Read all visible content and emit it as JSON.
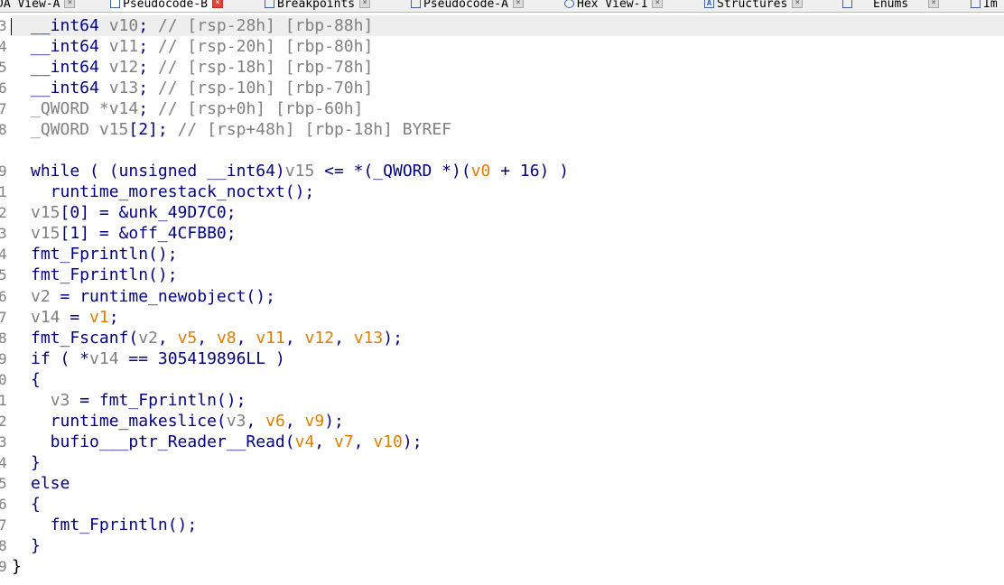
{
  "tabs": [
    {
      "label": "DA View-A",
      "icon": "none",
      "close": "normal",
      "active": false
    },
    {
      "label": "Pseudocode-B",
      "icon": "pseudocode-icon",
      "close": "red",
      "active": true
    },
    {
      "label": "Breakpoints",
      "icon": "breakpoints-icon",
      "close": "normal",
      "active": false
    },
    {
      "label": "Pseudocode-A",
      "icon": "pseudocode-icon",
      "close": "normal",
      "active": false
    },
    {
      "label": "Hex View-1",
      "icon": "hex-icon",
      "close": "normal",
      "active": false
    },
    {
      "label": "Structures",
      "icon": "structures-icon",
      "close": "normal",
      "active": false
    },
    {
      "label": "Enums",
      "icon": "enums-icon",
      "close": "normal",
      "active": false
    },
    {
      "label": "Im",
      "icon": "imports-icon",
      "close": "none",
      "active": false
    }
  ],
  "line_numbers": [
    "3",
    "4",
    "5",
    "6",
    "7",
    "8",
    "",
    "9",
    "1",
    "2",
    "3",
    "4",
    "5",
    "6",
    "7",
    "8",
    "9",
    "0",
    "1",
    "2",
    "3",
    "4",
    "5",
    "6",
    "7",
    "8",
    "9"
  ],
  "code_lines": [
    [
      [
        "__int64 ",
        "t-text"
      ],
      [
        "v10",
        "t-var"
      ],
      [
        "; ",
        "t-text"
      ],
      [
        "// [rsp-28h] [rbp-88h]",
        "t-cmt"
      ]
    ],
    [
      [
        "__int64 ",
        "t-text"
      ],
      [
        "v11",
        "t-var"
      ],
      [
        "; ",
        "t-text"
      ],
      [
        "// [rsp-20h] [rbp-80h]",
        "t-cmt"
      ]
    ],
    [
      [
        "__int64 ",
        "t-text"
      ],
      [
        "v12",
        "t-var"
      ],
      [
        "; ",
        "t-text"
      ],
      [
        "// [rsp-18h] [rbp-78h]",
        "t-cmt"
      ]
    ],
    [
      [
        "__int64 ",
        "t-text"
      ],
      [
        "v13",
        "t-var"
      ],
      [
        "; ",
        "t-text"
      ],
      [
        "// [rsp-10h] [rbp-70h]",
        "t-cmt"
      ]
    ],
    [
      [
        "_QWORD *",
        "t-var"
      ],
      [
        "v14",
        "t-var"
      ],
      [
        "; ",
        "t-text"
      ],
      [
        "// [rsp+0h] [rbp-60h]",
        "t-cmt"
      ]
    ],
    [
      [
        "_QWORD ",
        "t-var"
      ],
      [
        "v15",
        "t-var"
      ],
      [
        "[2]; ",
        "t-text"
      ],
      [
        "// [rsp+48h] [rbp-18h] BYREF",
        "t-cmt"
      ]
    ],
    [],
    [
      [
        "while ( (unsigned __int64)",
        "t-text"
      ],
      [
        "v15",
        "t-var"
      ],
      [
        " <= *(_QWORD *)(",
        "t-text"
      ],
      [
        "v0",
        "t-arg"
      ],
      [
        " + 16) )",
        "t-text"
      ]
    ],
    [
      [
        "  runtime_morestack_noctxt();",
        "t-text"
      ]
    ],
    [
      [
        "v15",
        "t-var"
      ],
      [
        "[0] = &unk_49D7C0;",
        "t-text"
      ]
    ],
    [
      [
        "v15",
        "t-var"
      ],
      [
        "[1] = &off_4CFBB0;",
        "t-text"
      ]
    ],
    [
      [
        "fmt_Fprintln();",
        "t-text"
      ]
    ],
    [
      [
        "fmt_Fprintln();",
        "t-text"
      ]
    ],
    [
      [
        "v2",
        "t-var"
      ],
      [
        " = runtime_newobject();",
        "t-text"
      ]
    ],
    [
      [
        "v14",
        "t-var"
      ],
      [
        " = ",
        "t-text"
      ],
      [
        "v1",
        "t-arg"
      ],
      [
        ";",
        "t-text"
      ]
    ],
    [
      [
        "fmt_Fscanf(",
        "t-text"
      ],
      [
        "v2",
        "t-var"
      ],
      [
        ", ",
        "t-text"
      ],
      [
        "v5",
        "t-arg"
      ],
      [
        ", ",
        "t-text"
      ],
      [
        "v8",
        "t-arg"
      ],
      [
        ", ",
        "t-text"
      ],
      [
        "v11",
        "t-arg"
      ],
      [
        ", ",
        "t-text"
      ],
      [
        "v12",
        "t-arg"
      ],
      [
        ", ",
        "t-text"
      ],
      [
        "v13",
        "t-arg"
      ],
      [
        ");",
        "t-text"
      ]
    ],
    [
      [
        "if ( *",
        "t-text"
      ],
      [
        "v14",
        "t-var"
      ],
      [
        " == 305419896LL )",
        "t-text"
      ]
    ],
    [
      [
        "{",
        "t-text"
      ]
    ],
    [
      [
        "  ",
        "t-text"
      ],
      [
        "v3",
        "t-var"
      ],
      [
        " = fmt_Fprintln();",
        "t-text"
      ]
    ],
    [
      [
        "  runtime_makeslice(",
        "t-text"
      ],
      [
        "v3",
        "t-var"
      ],
      [
        ", ",
        "t-text"
      ],
      [
        "v6",
        "t-arg"
      ],
      [
        ", ",
        "t-text"
      ],
      [
        "v9",
        "t-arg"
      ],
      [
        ");",
        "t-text"
      ]
    ],
    [
      [
        "  bufio___ptr_Reader__Read(",
        "t-text"
      ],
      [
        "v4",
        "t-arg"
      ],
      [
        ", ",
        "t-text"
      ],
      [
        "v7",
        "t-arg"
      ],
      [
        ", ",
        "t-text"
      ],
      [
        "v10",
        "t-arg"
      ],
      [
        ");",
        "t-text"
      ]
    ],
    [
      [
        "}",
        "t-text"
      ]
    ],
    [
      [
        "else",
        "t-text"
      ]
    ],
    [
      [
        "{",
        "t-text"
      ]
    ],
    [
      [
        "  fmt_Fprintln();",
        "t-text"
      ]
    ],
    [
      [
        "}",
        "t-text"
      ]
    ],
    [
      [
        "}",
        "t-black"
      ]
    ]
  ],
  "colors": {
    "keyword": "#000080",
    "variable": "#808080",
    "argument": "#e17d00",
    "background": "#ffffff",
    "highlight": "#eeeeee"
  }
}
